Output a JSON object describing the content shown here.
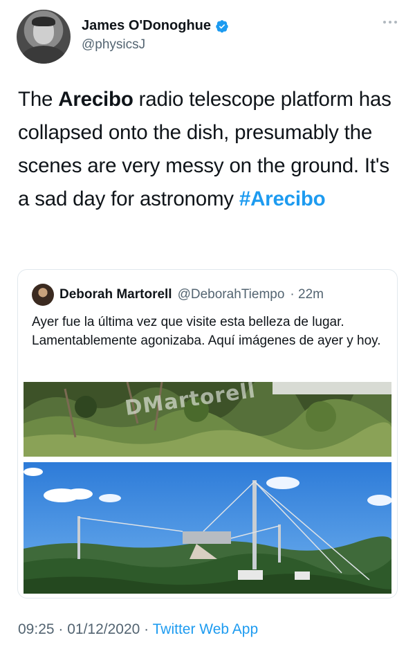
{
  "author": {
    "display_name": "James O'Donoghue",
    "handle": "@physicsJ",
    "verified": true,
    "verified_color": "#1d9bf0"
  },
  "tweet": {
    "text_before": "The ",
    "bold_word": "Arecibo",
    "text_after": " radio telescope platform has collapsed onto the dish, presumably the scenes are very messy on the ground. It's a sad day for astronomy ",
    "hashtag": "#Arecibo"
  },
  "quoted_tweet": {
    "name": "Deborah Martorell",
    "handle": "@DeborahTiempo",
    "time": "· 22m",
    "text": "Ayer fue la última vez que visite esta belleza de lugar. Lamentablemente agonizaba. Aquí imágenes de ayer y hoy.",
    "image_watermark": "DMartorell"
  },
  "footer": {
    "timestamp": "09:25 · 01/12/2020 ·",
    "source": "Twitter Web App"
  },
  "colors": {
    "accent": "#1d9bf0",
    "secondary_text": "#536471"
  }
}
